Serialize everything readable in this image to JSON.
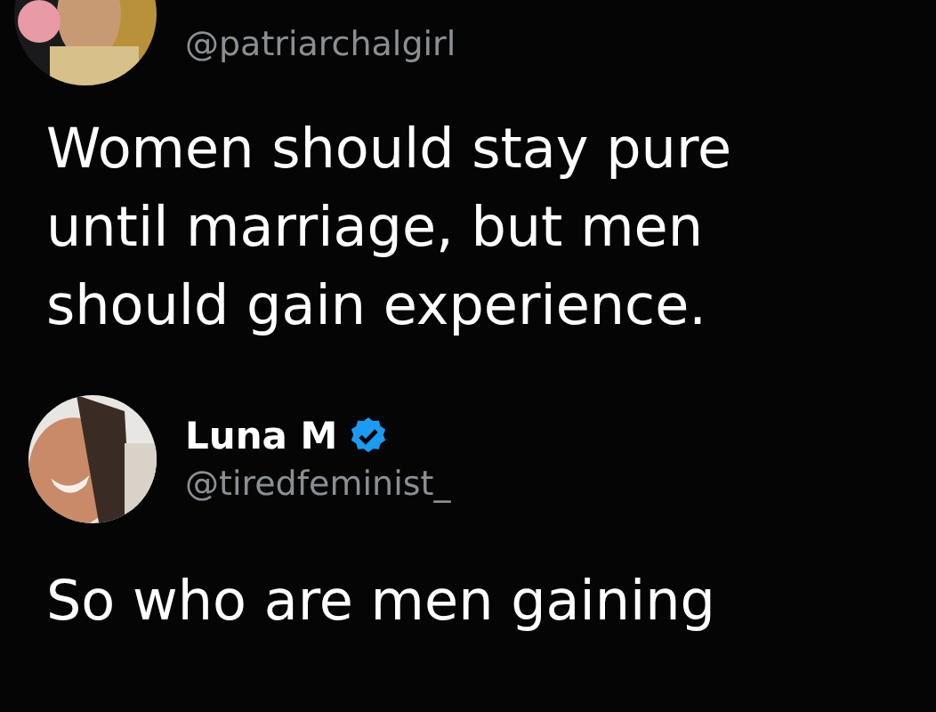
{
  "tweets": [
    {
      "avatar": {
        "kind": "picture"
      },
      "handle": "@patriarchalgirl",
      "text_lines": [
        "Women should stay pure",
        "until marriage, but men",
        "should gain experience."
      ]
    },
    {
      "avatar": {
        "kind": "picture"
      },
      "name": "Luna M",
      "verified": true,
      "handle": "@tiredfeminist_",
      "text_lines": [
        "So who are men gaining"
      ]
    }
  ]
}
